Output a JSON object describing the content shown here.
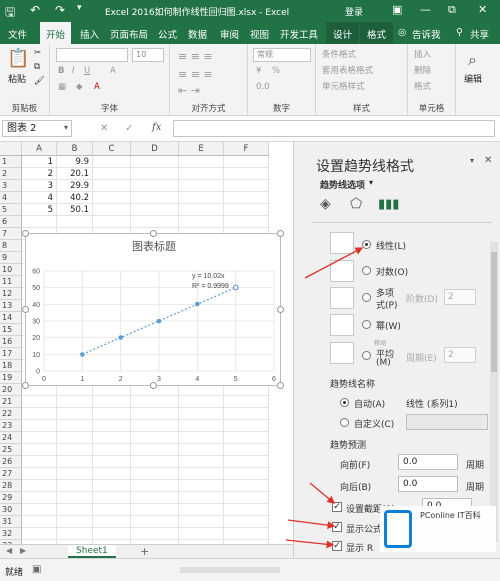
{
  "window": {
    "title": "Excel 2016如何制作线性回归图.xlsx - Excel",
    "login": "登录",
    "restore": "⧉",
    "minimize": "—"
  },
  "tabs": [
    "文件",
    "开始",
    "插入",
    "页面布局",
    "公式",
    "数据",
    "审阅",
    "视图",
    "开发工具",
    "设计",
    "格式"
  ],
  "tell_me": "告诉我",
  "share": "共享",
  "ribbon": {
    "paste": "粘贴",
    "clipboard": "剪贴板",
    "font_size": "10",
    "font": "字体",
    "align": "对齐方式",
    "number_format": "常规",
    "number": "数字",
    "cond_format": "条件格式",
    "table_format": "套用表格格式",
    "cell_style": "单元格样式",
    "style": "样式",
    "insert": "插入",
    "delete": "删除",
    "format": "格式",
    "cells": "单元格",
    "edit": "编辑",
    "font_bold": "B",
    "font_italic": "I",
    "font_underline": "U",
    "percent": "%",
    "grow_font": "A",
    "font_color": "A",
    "number_sample": "0.0"
  },
  "formula_bar": {
    "name_box": "图表 2",
    "fx": "fx",
    "cancel": "✕",
    "enter": "✓"
  },
  "sheet": {
    "columns": [
      "A",
      "B",
      "C",
      "D",
      "E",
      "F"
    ],
    "rows": [
      "1",
      "2",
      "3",
      "4",
      "5",
      "6",
      "7",
      "8",
      "9",
      "10",
      "11",
      "12",
      "13",
      "14",
      "15",
      "16",
      "17",
      "18",
      "19",
      "20",
      "21",
      "22",
      "23",
      "24",
      "25",
      "26",
      "27",
      "28",
      "29",
      "30",
      "31",
      "32",
      "33"
    ],
    "data": [
      {
        "a": "1",
        "b": "9.9"
      },
      {
        "a": "2",
        "b": "20.1"
      },
      {
        "a": "3",
        "b": "29.9"
      },
      {
        "a": "4",
        "b": "40.2"
      },
      {
        "a": "5",
        "b": "50.1"
      }
    ],
    "tab": "Sheet1",
    "add_sheet": "+"
  },
  "chart_data": {
    "type": "scatter",
    "title": "图表标题",
    "x": [
      1,
      2,
      3,
      4,
      5
    ],
    "y": [
      9.9,
      20.1,
      29.9,
      40.2,
      50.1
    ],
    "xlim": [
      0,
      6
    ],
    "ylim": [
      0,
      60
    ],
    "xticks": [
      "0",
      "1",
      "2",
      "3",
      "4",
      "5",
      "6"
    ],
    "yticks": [
      "0",
      "10",
      "20",
      "30",
      "40",
      "50",
      "60"
    ],
    "trendline": {
      "type": "linear",
      "slope": 10.02,
      "equation": "y = 10.02x",
      "r2": "R² = 0.9999"
    },
    "point_color": "#5b9bd5",
    "grid": true
  },
  "pane": {
    "title": "设置趋势线格式",
    "subtitle": "趋势线选项",
    "close": "✕",
    "options": [
      {
        "label": "线性(L)",
        "selected": true
      },
      {
        "label": "对数(O)",
        "selected": false
      },
      {
        "label": "多项",
        "label2": "式(P)",
        "extra": "阶数(D)",
        "spin": "2",
        "selected": false
      },
      {
        "label": "幂(W)",
        "selected": false
      },
      {
        "label_top": "移动",
        "label": "平均",
        "label2": "(M)",
        "extra": "周期(E)",
        "spin": "2",
        "selected": false
      }
    ],
    "trend_name_heading": "趋势线名称",
    "auto_label": "自动(A)",
    "auto_value": "线性 (系列1)",
    "custom_label": "自定义(C)",
    "forecast_heading": "趋势预测",
    "forward_label": "向前(F)",
    "forward_value": "0.0",
    "backward_label": "向后(B)",
    "backward_value": "0.0",
    "period": "周期",
    "intercept_label": "设置截距(S)",
    "intercept_value": "0.0",
    "show_eq_label": "显示公式",
    "show_r2_label": "显示 R",
    "check_mark": "✓"
  },
  "status": {
    "ready": "就绪",
    "nav_prev": "◀",
    "nav_next": "▶"
  },
  "watermark": "PConline IT百科",
  "accent": "#217346",
  "arrow_color": "#e0302a"
}
